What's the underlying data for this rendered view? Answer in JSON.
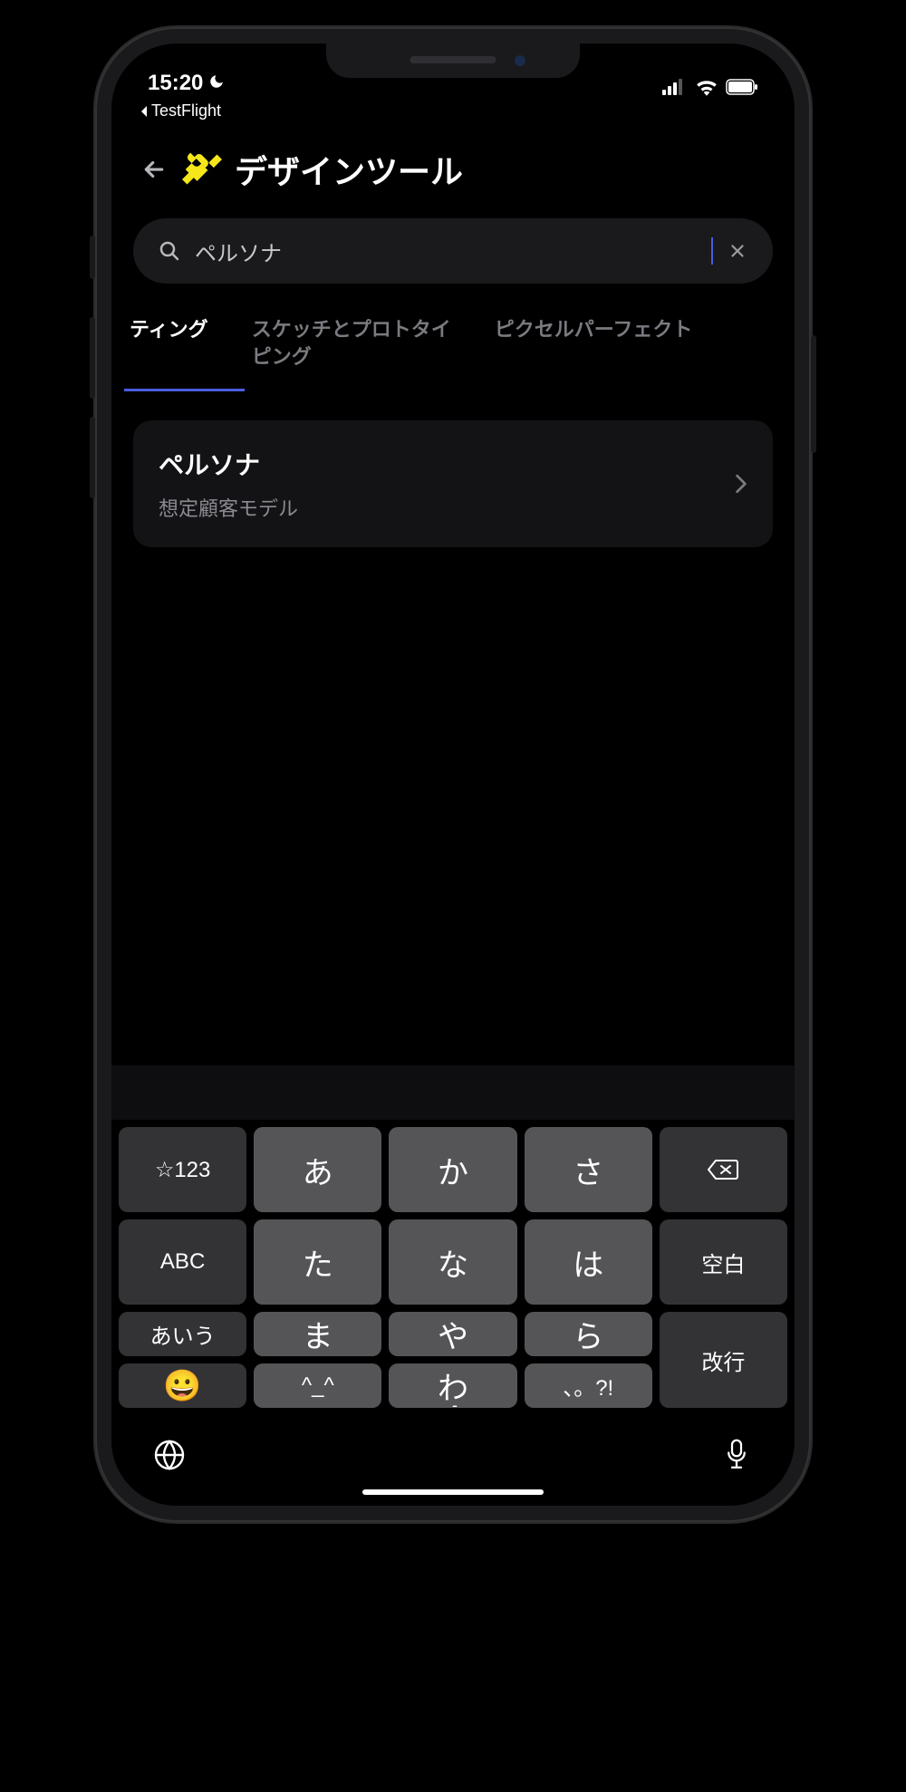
{
  "status": {
    "time": "15:20",
    "breadcrumb": "TestFlight"
  },
  "header": {
    "title": "デザインツール"
  },
  "search": {
    "value": "ペルソナ",
    "placeholder": ""
  },
  "tabs": [
    {
      "label": "ティング",
      "active": true
    },
    {
      "label": "スケッチとプロトタイピング",
      "active": false
    },
    {
      "label": "ピクセルパーフェクト",
      "active": false
    }
  ],
  "result": {
    "title": "ペルソナ",
    "subtitle": "想定顧客モデル"
  },
  "keyboard": {
    "rows": [
      [
        "☆123",
        "あ",
        "か",
        "さ"
      ],
      [
        "ABC",
        "た",
        "な",
        "は"
      ],
      [
        "あいう",
        "ま",
        "や",
        "ら"
      ],
      [
        "😀",
        "^_^",
        "わ",
        "、。?!"
      ]
    ],
    "backspace": "⌫",
    "space": "空白",
    "return": "改行"
  }
}
